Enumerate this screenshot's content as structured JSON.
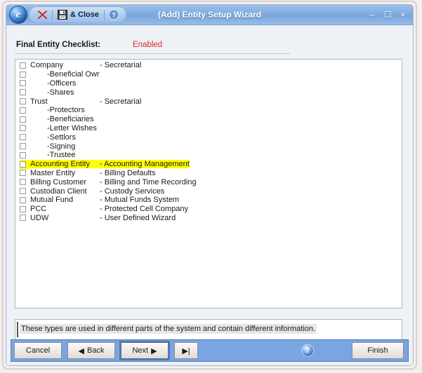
{
  "window": {
    "title": "(Add) Entity Setup Wizard",
    "app_icon": "e",
    "toolbar": {
      "cancel_icon": "red-x-icon",
      "save_icon": "floppy-disk-icon",
      "save_close_label": "& Close",
      "help_icon": "help-icon"
    },
    "controls": {
      "minimize": "–",
      "maximize": "☐",
      "close": "×"
    }
  },
  "header": {
    "title": "Final Entity Checklist:",
    "status": "Enabled",
    "status_color": "#e02a2a"
  },
  "checklist": {
    "highlight_color": "#ffff00",
    "rows": [
      {
        "name": "Company",
        "desc": "- Secretarial",
        "indent": false,
        "checked": false,
        "highlight": false
      },
      {
        "name": "-Beneficial Owner",
        "desc": "",
        "indent": true,
        "checked": false,
        "highlight": false
      },
      {
        "name": "-Officers",
        "desc": "",
        "indent": true,
        "checked": false,
        "highlight": false
      },
      {
        "name": "-Shares",
        "desc": "",
        "indent": true,
        "checked": false,
        "highlight": false
      },
      {
        "name": "Trust",
        "desc": "- Secretarial",
        "indent": false,
        "checked": false,
        "highlight": false
      },
      {
        "name": "-Protectors",
        "desc": "",
        "indent": true,
        "checked": false,
        "highlight": false
      },
      {
        "name": "-Beneficiaries",
        "desc": "",
        "indent": true,
        "checked": false,
        "highlight": false
      },
      {
        "name": "-Letter Wishes",
        "desc": "",
        "indent": true,
        "checked": false,
        "highlight": false
      },
      {
        "name": "-Settlors",
        "desc": "",
        "indent": true,
        "checked": false,
        "highlight": false
      },
      {
        "name": "-Signing",
        "desc": "",
        "indent": true,
        "checked": false,
        "highlight": false
      },
      {
        "name": "-Trustee",
        "desc": "",
        "indent": true,
        "checked": false,
        "highlight": false
      },
      {
        "name": "Accounting Entity",
        "desc": "- Accounting Management",
        "indent": false,
        "checked": false,
        "highlight": true
      },
      {
        "name": "Master Entity",
        "desc": "- Billing Defaults",
        "indent": false,
        "checked": false,
        "highlight": false
      },
      {
        "name": "Billing Customer",
        "desc": "- Billing and Time Recording",
        "indent": false,
        "checked": false,
        "highlight": false
      },
      {
        "name": "Custodian Client",
        "desc": "- Custody Services",
        "indent": false,
        "checked": false,
        "highlight": false
      },
      {
        "name": "Mutual Fund",
        "desc": "- Mutual Funds System",
        "indent": false,
        "checked": false,
        "highlight": false
      },
      {
        "name": "PCC",
        "desc": "- Protected Cell Company",
        "indent": false,
        "checked": false,
        "highlight": false
      },
      {
        "name": "UDW",
        "desc": "- User Defined Wizard",
        "indent": false,
        "checked": false,
        "highlight": false
      }
    ]
  },
  "info": {
    "text": "These types are used in different parts of the system and contain different information."
  },
  "buttonbar": {
    "background_color": "#7aa4e2",
    "cancel_label": "Cancel",
    "back_label": "Back",
    "back_arrow": "◀",
    "next_label": "Next",
    "next_arrow": "▶",
    "last_label": "▶|",
    "help_icon": "help-icon",
    "help_glyph": "?",
    "finish_label": "Finish"
  }
}
